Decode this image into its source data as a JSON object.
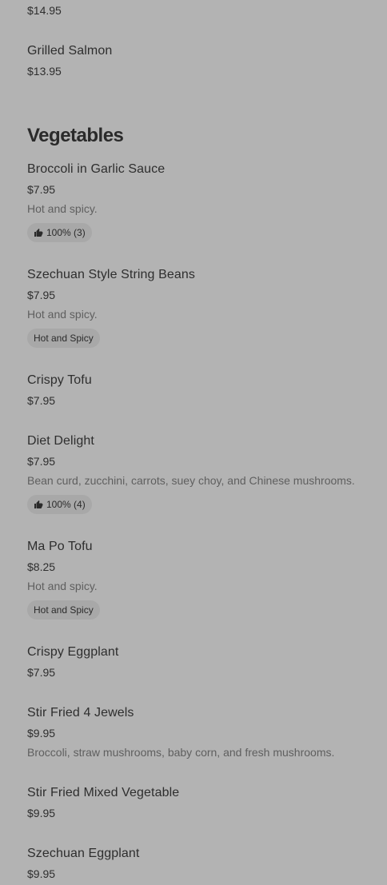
{
  "top_partial_price": "$14.95",
  "items_above": [
    {
      "name": "Grilled Salmon",
      "price": "$13.95"
    }
  ],
  "section": {
    "title": "Vegetables"
  },
  "items": [
    {
      "name": "Broccoli in Garlic Sauce",
      "price": "$7.95",
      "desc": "Hot and spicy.",
      "badge": "100% (3)",
      "badge_icon": "thumbs-up-icon"
    },
    {
      "name": "Szechuan Style String Beans",
      "price": "$7.95",
      "desc": "Hot and spicy.",
      "badge": "Hot and Spicy"
    },
    {
      "name": "Crispy Tofu",
      "price": "$7.95"
    },
    {
      "name": "Diet Delight",
      "price": "$7.95",
      "desc": "Bean curd, zucchini, carrots, suey choy, and Chinese mushrooms.",
      "badge": "100% (4)",
      "badge_icon": "thumbs-up-icon"
    },
    {
      "name": "Ma Po Tofu",
      "price": "$8.25",
      "desc": "Hot and spicy.",
      "badge": "Hot and Spicy"
    },
    {
      "name": "Crispy Eggplant",
      "price": "$7.95"
    },
    {
      "name": "Stir Fried 4 Jewels",
      "price": "$9.95",
      "desc": "Broccoli, straw mushrooms, baby corn, and fresh mushrooms."
    },
    {
      "name": "Stir Fried Mixed Vegetable",
      "price": "$9.95"
    },
    {
      "name": "Szechuan Eggplant",
      "price": "$9.95"
    }
  ]
}
